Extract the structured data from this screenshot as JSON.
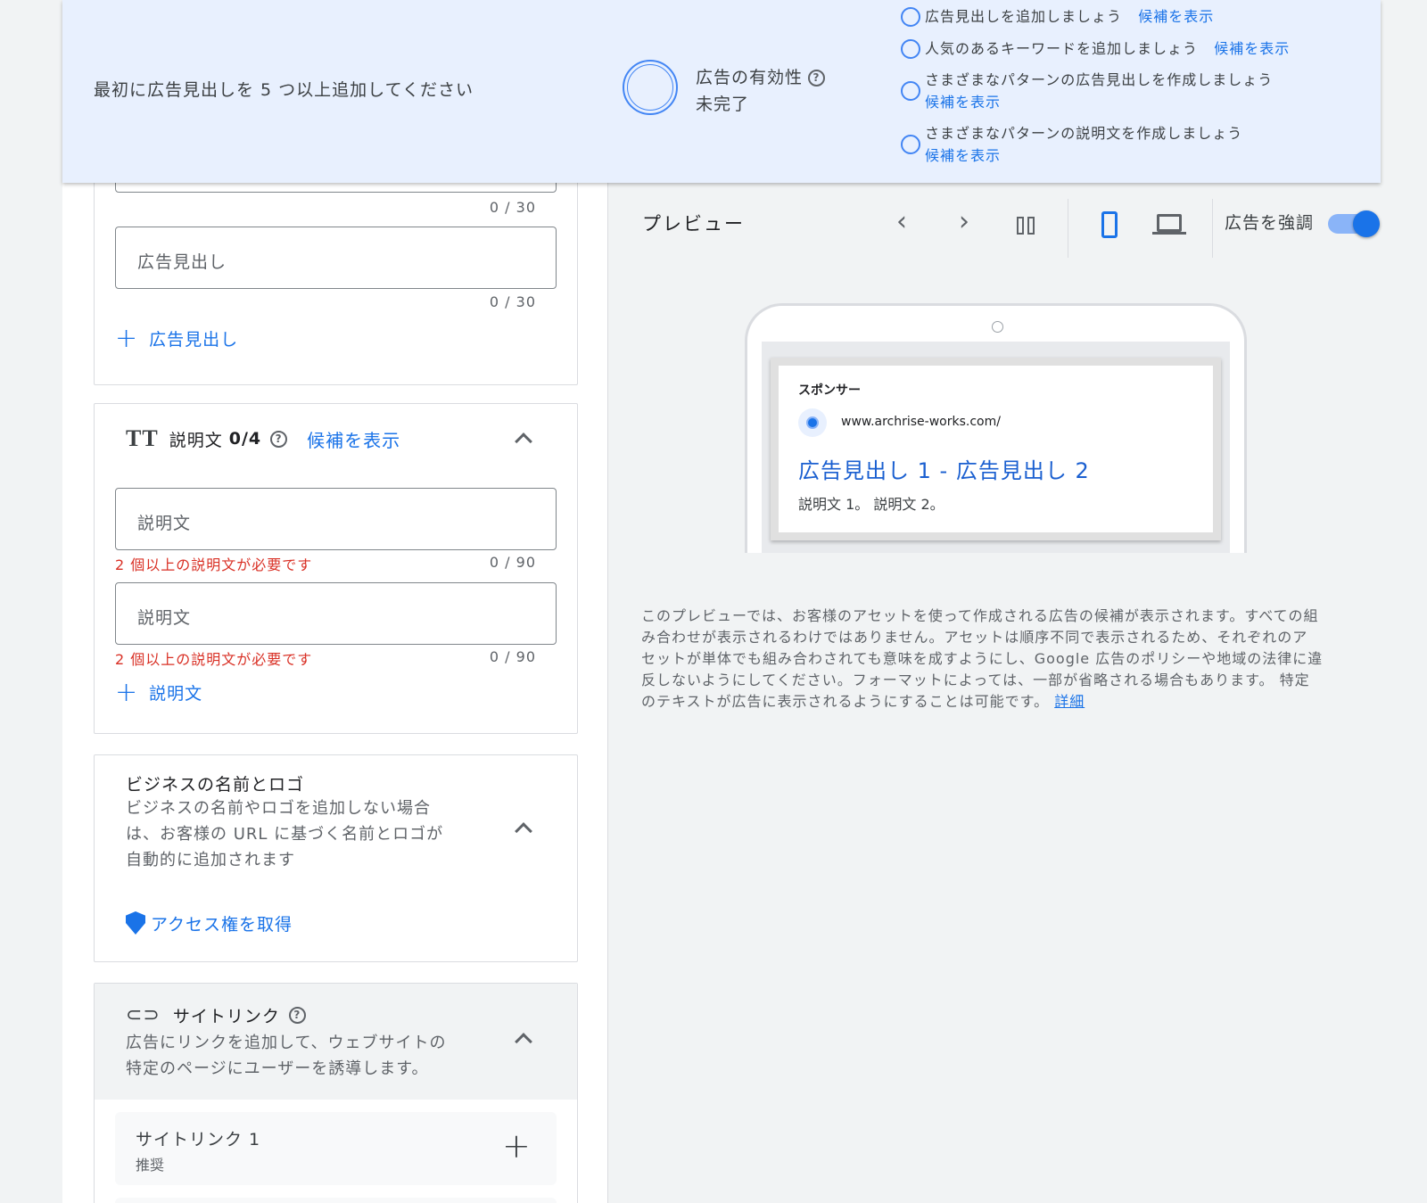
{
  "banner": {
    "message": "最初に広告見出しを 5 つ以上追加してください",
    "effectiveness_title": "広告の有効性",
    "effectiveness_status": "未完了",
    "tips": [
      {
        "text": "広告見出しを追加しましょう",
        "link": "候補を表示"
      },
      {
        "text": "人気のあるキーワードを追加しましょう",
        "link": "候補を表示"
      },
      {
        "text": "さまざまなパターンの広告見出しを作成しましょう",
        "link": "候補を表示"
      },
      {
        "text": "さまざまなパターンの説明文を作成しましょう",
        "link": "候補を表示"
      }
    ]
  },
  "headlines": {
    "counter_top": "0 / 30",
    "input_placeholder": "広告見出し",
    "counter": "0 / 30",
    "add_label": "広告見出し"
  },
  "descriptions": {
    "title": "説明文",
    "count": "0/4",
    "suggest_link": "候補を表示",
    "inputs": [
      {
        "placeholder": "説明文",
        "error": "2 個以上の説明文が必要です",
        "counter": "0 / 90"
      },
      {
        "placeholder": "説明文",
        "error": "2 個以上の説明文が必要です",
        "counter": "0 / 90"
      }
    ],
    "add_label": "説明文"
  },
  "business": {
    "title": "ビジネスの名前とロゴ",
    "desc_lines": [
      "ビジネスの名前やロゴを追加しない場合",
      "は、お客様の URL に基づく名前とロゴが",
      "自動的に追加されます"
    ],
    "access_link": "アクセス権を取得"
  },
  "sitelinks": {
    "title": "サイトリンク",
    "desc_lines": [
      "広告にリンクを追加して、ウェブサイトの",
      "特定のページにユーザーを誘導します。"
    ],
    "item_title": "サイトリンク 1",
    "item_sub": "推奨"
  },
  "preview": {
    "title": "プレビュー",
    "toggle_label": "広告を強調",
    "toggle_on": true,
    "ad": {
      "sponsor": "スポンサー",
      "url": "www.archrise-works.com/",
      "headline": "広告見出し 1 - 広告見出し 2",
      "description": "説明文 1。 説明文 2。"
    },
    "note_lines": [
      "このプレビューでは、お客様のアセットを使って作成される広告の候補が表示されます。すべての組",
      "み合わせが表示されるわけではありません。アセットは順序不同で表示されるため、それぞれのア",
      "セットが単体でも組み合わされても意味を成すようにし、Google 広告のポリシーや地域の法律に違",
      "反しないようにしてください。フォーマットによっては、一部が省略される場合もあります。 特定",
      "のテキストが広告に表示されるようにすることは可能です。"
    ],
    "note_link": "詳細"
  },
  "colors": {
    "accent": "#1a73e8",
    "banner_bg": "#e8f0fe",
    "error": "#d93025"
  }
}
